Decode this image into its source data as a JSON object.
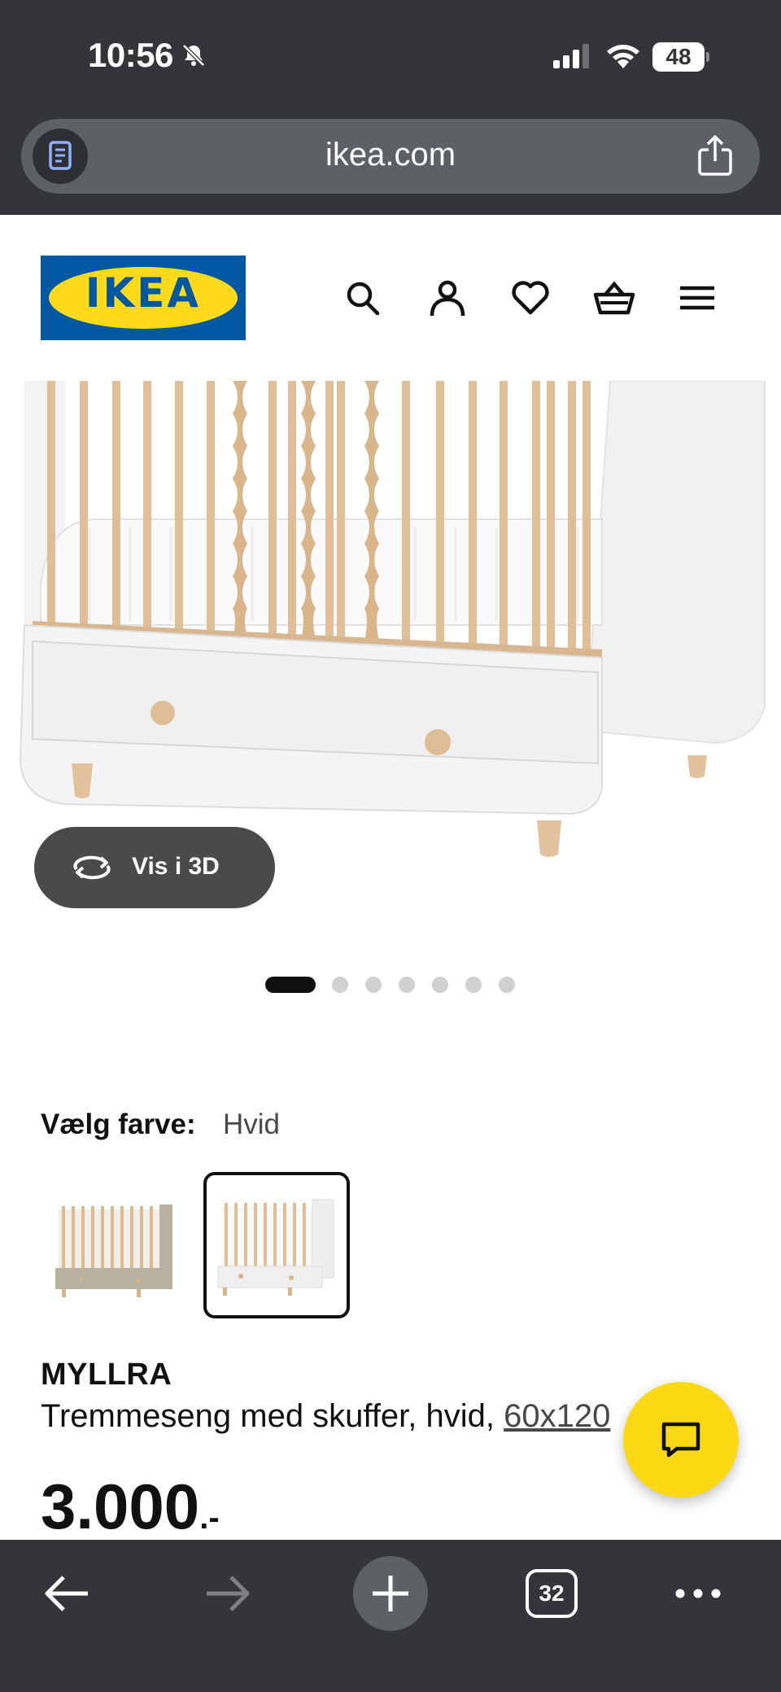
{
  "status_bar": {
    "time": "10:56",
    "battery": "48"
  },
  "browser": {
    "url": "ikea.com",
    "tab_count": "32"
  },
  "header": {
    "logo_text": "IKEA",
    "icons": [
      "search-icon",
      "account-icon",
      "heart-icon",
      "basket-icon",
      "menu-icon"
    ]
  },
  "gallery": {
    "view_3d_label": "Vis i 3D",
    "image_count": 7,
    "active_index": 0
  },
  "color_picker": {
    "label": "Vælg farve:",
    "selected": "Hvid",
    "swatch_count": 2,
    "selected_index": 1
  },
  "product": {
    "name": "MYLLRA",
    "description": "Tremmeseng med skuffer, hvid, ",
    "size_link": "60x120",
    "price": "3.000",
    "price_suffix": ".-"
  },
  "colors": {
    "ikea_blue": "#0058a3",
    "ikea_yellow": "#ffda1a",
    "chat_yellow": "#fbd914",
    "browser_chrome": "#333538"
  }
}
